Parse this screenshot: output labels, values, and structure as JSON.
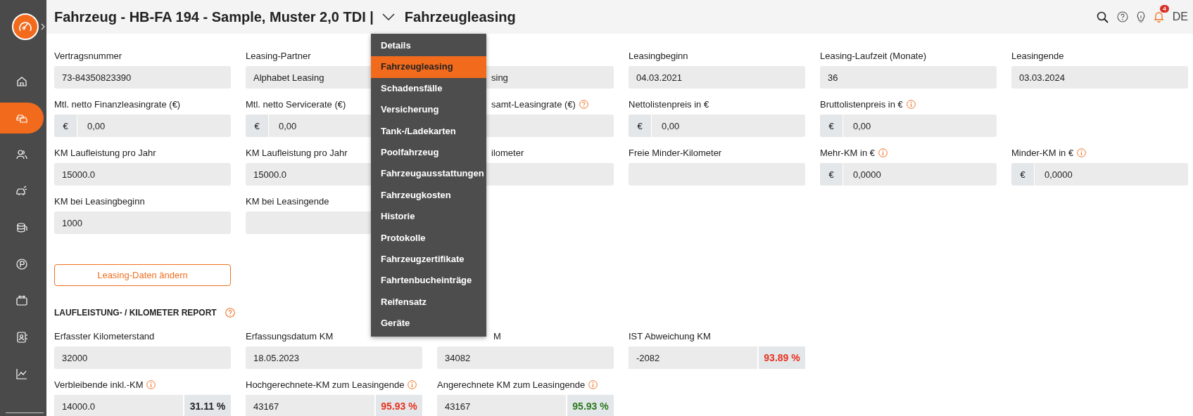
{
  "sidebar": {
    "items": [
      {
        "selected": false
      },
      {
        "selected": true
      },
      {
        "selected": false
      },
      {
        "selected": false
      },
      {
        "selected": false
      },
      {
        "selected": false
      },
      {
        "selected": false
      },
      {
        "selected": false
      },
      {
        "selected": false
      }
    ]
  },
  "header": {
    "title": "Fahrzeug - HB-FA 194 - Sample, Muster 2,0 TDI |",
    "section": "Fahrzeugleasing",
    "notification_count": "4",
    "language": "DE"
  },
  "menu": {
    "items": [
      {
        "label": "Details",
        "selected": false
      },
      {
        "label": "Fahrzeugleasing",
        "selected": true
      },
      {
        "label": "Schadensfälle",
        "selected": false
      },
      {
        "label": "Versicherung",
        "selected": false
      },
      {
        "label": "Tank-/Ladekarten",
        "selected": false
      },
      {
        "label": "Poolfahrzeug",
        "selected": false
      },
      {
        "label": "Fahrzeugausstattungen",
        "selected": false
      },
      {
        "label": "Fahrzeugkosten",
        "selected": false
      },
      {
        "label": "Historie",
        "selected": false
      },
      {
        "label": "Protokolle",
        "selected": false
      },
      {
        "label": "Fahrzeugzertifikate",
        "selected": false
      },
      {
        "label": "Fahrtenbucheinträge",
        "selected": false
      },
      {
        "label": "Reifensatz",
        "selected": false
      },
      {
        "label": "Geräte",
        "selected": false
      }
    ]
  },
  "leasing_rows": [
    [
      {
        "kind": "text",
        "label": "Vertragsnummer",
        "value": "73-84350823390"
      },
      {
        "kind": "text",
        "label": "Leasing-Partner",
        "value": "Alphabet Leasing"
      },
      {
        "kind": "text",
        "value": "sing"
      },
      {
        "kind": "text",
        "label": "Leasingbeginn",
        "value": "04.03.2021"
      },
      {
        "kind": "text",
        "label": "Leasing-Laufzeit (Monate)",
        "value": "36"
      },
      {
        "kind": "text",
        "label": "Leasingende",
        "value": "03.03.2024"
      }
    ],
    [
      {
        "kind": "currency",
        "label": "Mtl. netto Finanzleasingrate (€)",
        "prefix": "€",
        "value": "0,00"
      },
      {
        "kind": "currency",
        "label": "Mtl. netto Servicerate (€)",
        "prefix": "€",
        "value": "0,00"
      },
      {
        "kind": "text",
        "label": "samt-Leasingrate (€)",
        "help": true
      },
      {
        "kind": "currency",
        "label": "Nettolistenpreis in €",
        "prefix": "€",
        "value": "0,00"
      },
      {
        "kind": "currency",
        "label": "Bruttolistenpreis in €",
        "info": true,
        "prefix": "€",
        "value": "0,00"
      }
    ],
    [
      {
        "kind": "text",
        "label": "KM Laufleistung pro Jahr",
        "value": "15000.0"
      },
      {
        "kind": "text",
        "label": "KM Laufleistung pro Jahr",
        "value": "15000.0"
      },
      {
        "kind": "text",
        "label": "ilometer"
      },
      {
        "kind": "text",
        "label": "Freie Minder-Kilometer"
      },
      {
        "kind": "currency",
        "label": "Mehr-KM in €",
        "info": true,
        "prefix": "€",
        "value": "0,0000"
      },
      {
        "kind": "currency",
        "label": "Minder-KM in €",
        "info": true,
        "prefix": "€",
        "value": "0,0000"
      }
    ],
    [
      {
        "kind": "text",
        "label": "KM bei Leasingbeginn",
        "value": "1000"
      },
      {
        "kind": "text",
        "label": "KM bei Leasingende"
      }
    ]
  ],
  "edit_button": "Leasing-Daten ändern",
  "report": {
    "title": "LAUFLEISTUNG- / KILOMETER REPORT",
    "help": true,
    "rows": [
      [
        {
          "kind": "text",
          "label": "Erfasster Kilometerstand",
          "value": "32000"
        },
        {
          "kind": "text",
          "label": "Erfassungsdatum KM",
          "value": "18.05.2023"
        },
        {
          "kind": "text",
          "label": "M",
          "value": "34082"
        },
        {
          "kind": "percent",
          "label": "IST Abweichung KM",
          "value": "-2082",
          "percent": "93.89 %",
          "color": "#e8321e"
        }
      ],
      [
        {
          "kind": "percent",
          "label": "Verbleibende inkl.-KM",
          "info": true,
          "value": "14000.0",
          "percent": "31.11 %",
          "color": "#222222"
        },
        {
          "kind": "percent",
          "label": "Hochgerechnete-KM zum Leasingende",
          "info": true,
          "value": "43167",
          "percent": "95.93 %",
          "color": "#e8321e"
        },
        {
          "kind": "percent",
          "label": "Angerechnete KM zum Leasingende",
          "info": true,
          "value": "43167",
          "percent": "95.93 %",
          "color": "#2a7a1e"
        }
      ]
    ]
  }
}
